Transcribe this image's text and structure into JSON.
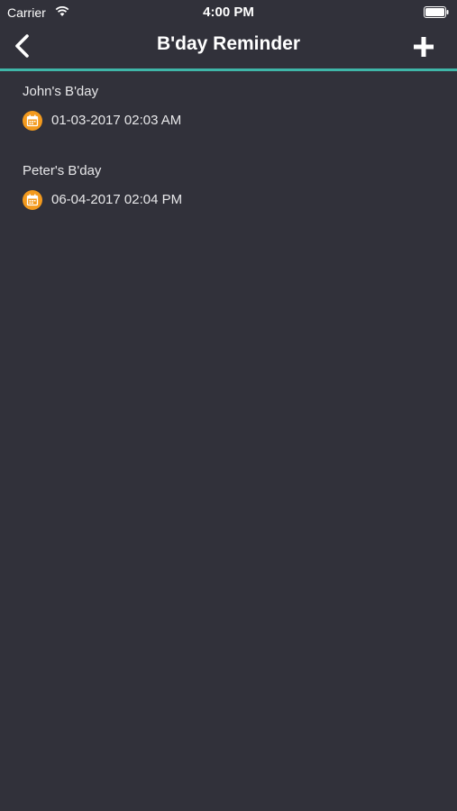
{
  "status_bar": {
    "carrier": "Carrier",
    "time": "4:00 PM"
  },
  "nav": {
    "title": "B'day Reminder",
    "back_icon": "chevron-left-icon",
    "add_icon": "plus-icon"
  },
  "colors": {
    "background": "#31313a",
    "accent_line": "#3fb6a8",
    "calendar_icon": "#f39a1e"
  },
  "reminders": [
    {
      "name": "John's B'day",
      "datetime": "01-03-2017 02:03 AM"
    },
    {
      "name": "Peter's B'day",
      "datetime": "06-04-2017 02:04 PM"
    }
  ]
}
